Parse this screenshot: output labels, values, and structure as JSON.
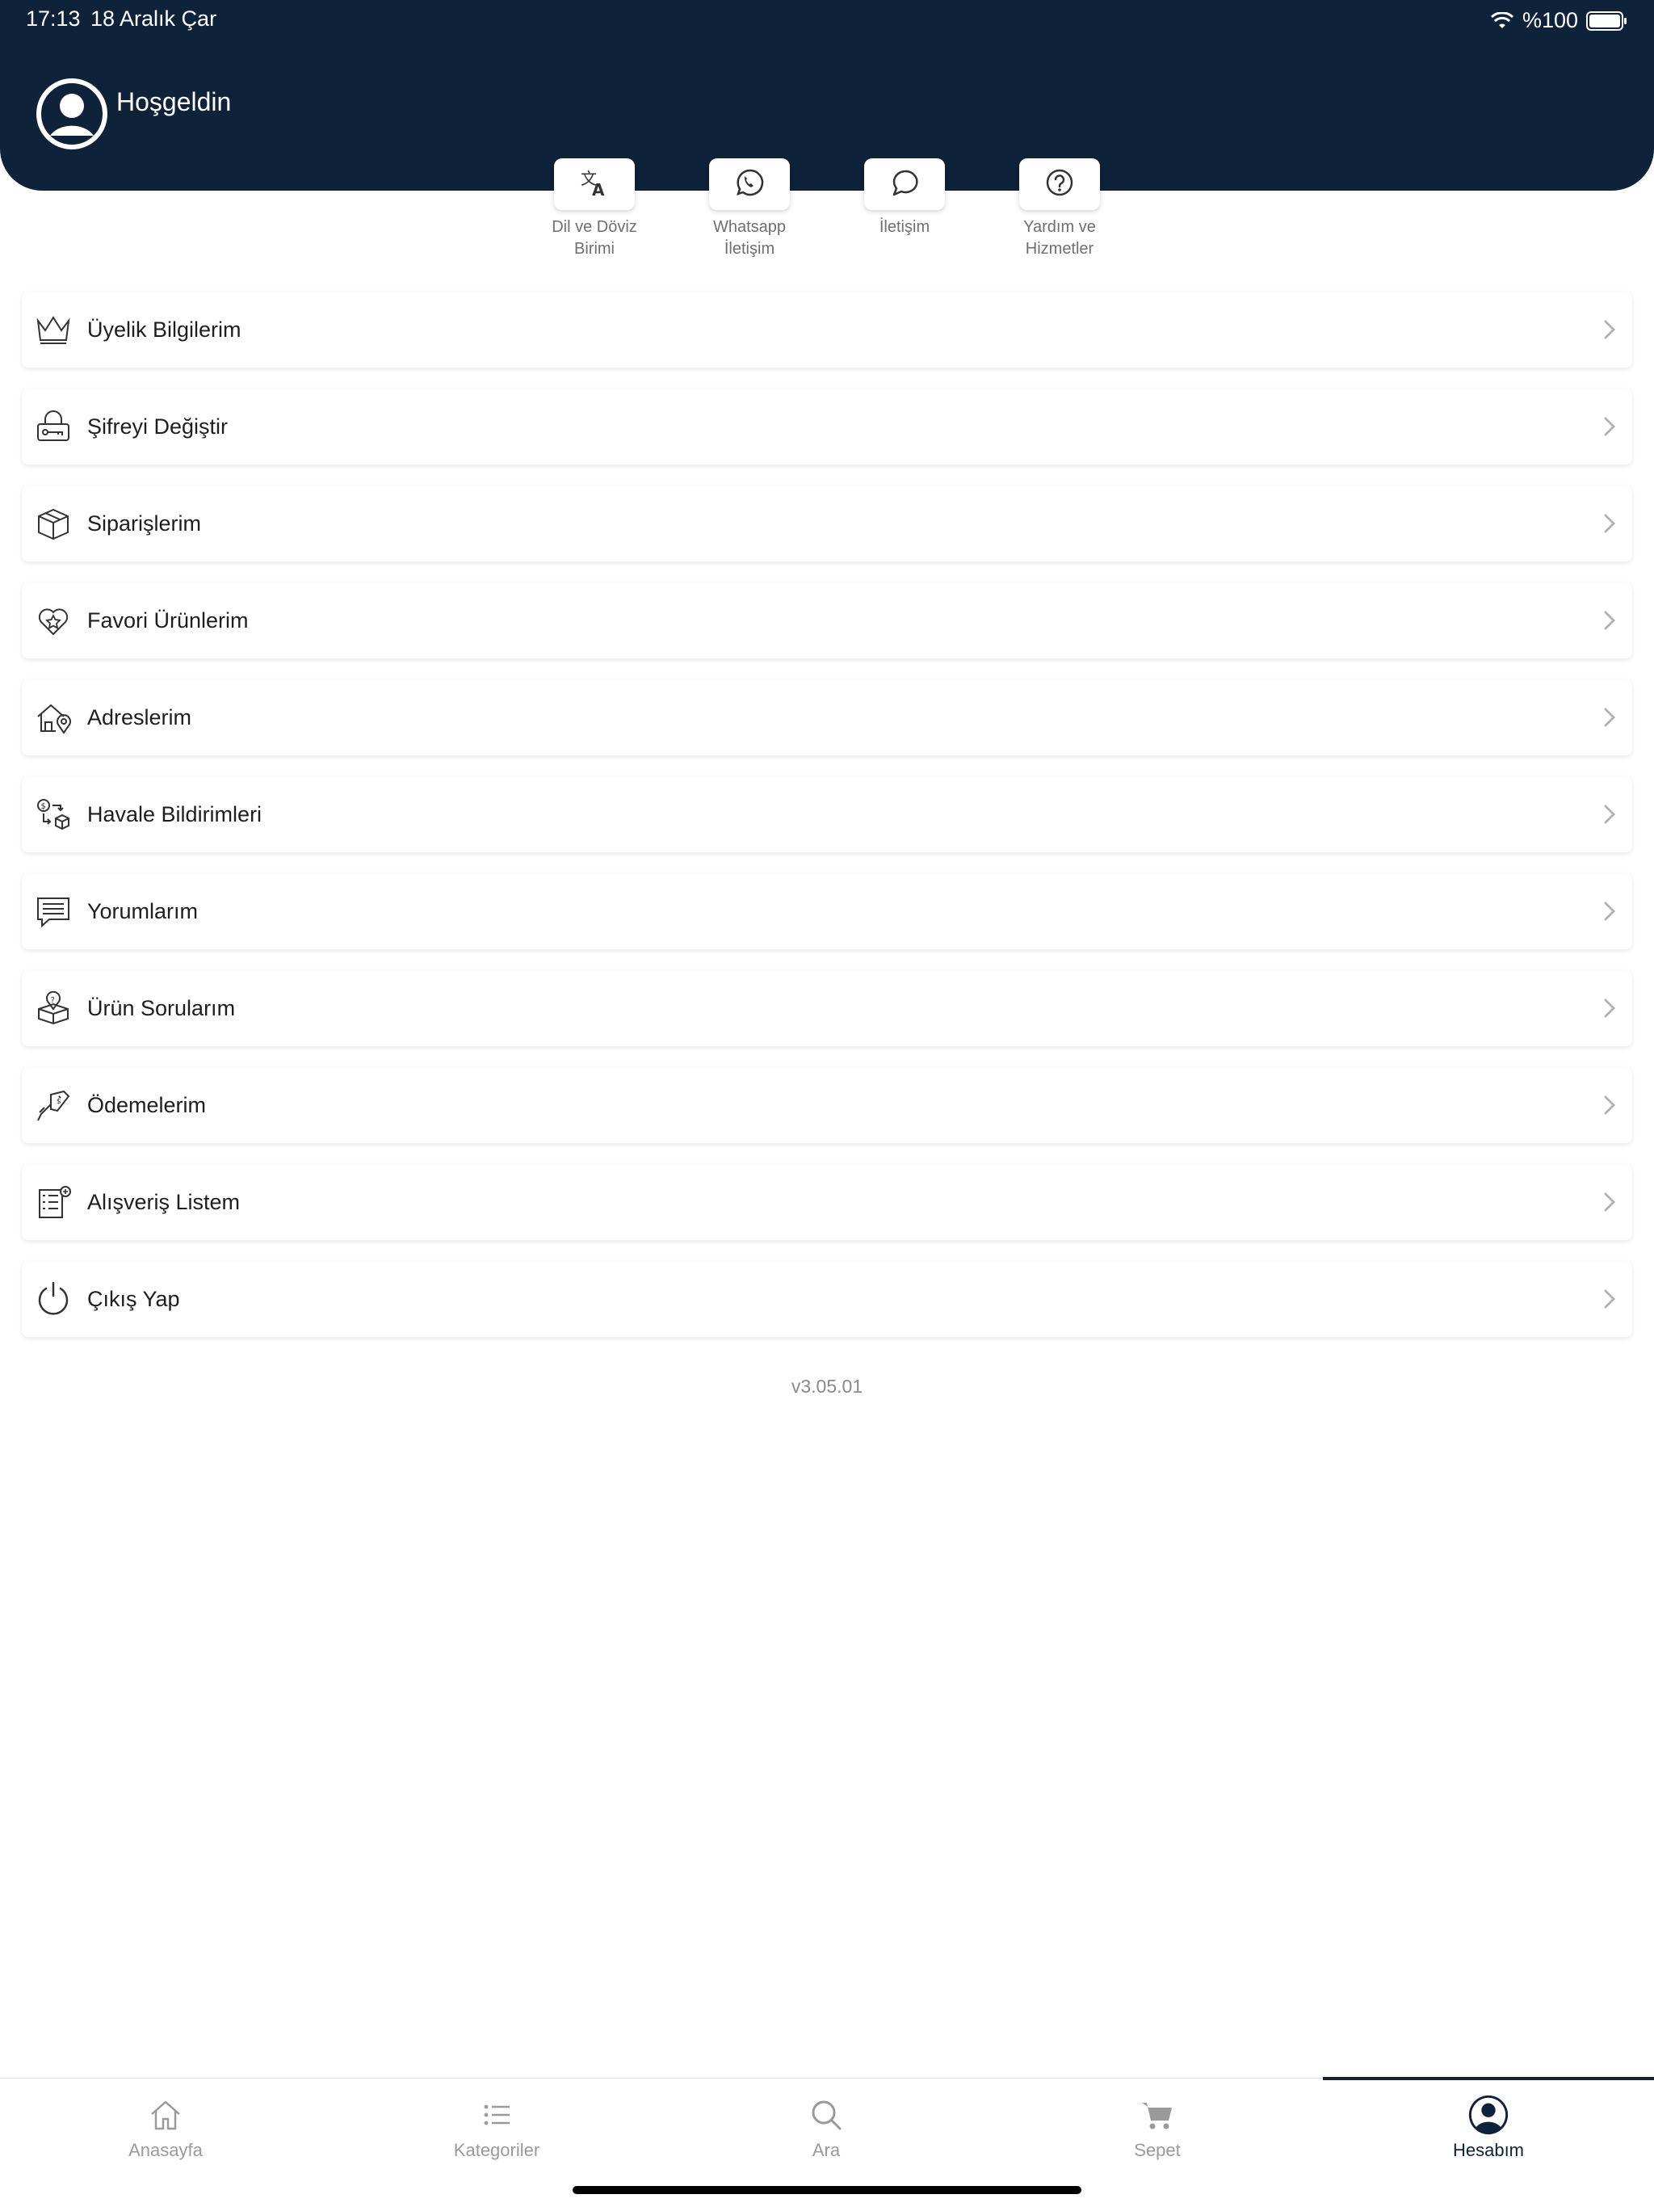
{
  "status_bar": {
    "time": "17:13",
    "date": "18 Aralık Çar",
    "battery": "%100"
  },
  "header": {
    "welcome": "Hoşgeldin",
    "background_color": "#0e223a"
  },
  "quick_actions": [
    {
      "icon": "translate-icon",
      "label_line1": "Dil ve Döviz",
      "label_line2": "Birimi"
    },
    {
      "icon": "whatsapp-icon",
      "label_line1": "Whatsapp",
      "label_line2": "İletişim"
    },
    {
      "icon": "chat-bubble-icon",
      "label_line1": "İletişim",
      "label_line2": ""
    },
    {
      "icon": "help-icon",
      "label_line1": "Yardım ve",
      "label_line2": "Hizmetler"
    }
  ],
  "menu": [
    {
      "icon": "crown-icon",
      "label": "Üyelik Bilgilerim"
    },
    {
      "icon": "lock-key-icon",
      "label": "Şifreyi Değiştir"
    },
    {
      "icon": "package-box-icon",
      "label": "Siparişlerim"
    },
    {
      "icon": "heart-star-icon",
      "label": "Favori Ürünlerim"
    },
    {
      "icon": "home-location-icon",
      "label": "Adreslerim"
    },
    {
      "icon": "money-transfer-icon",
      "label": "Havale Bildirimleri"
    },
    {
      "icon": "comment-icon",
      "label": "Yorumlarım"
    },
    {
      "icon": "question-box-icon",
      "label": "Ürün Sorularım"
    },
    {
      "icon": "card-payment-icon",
      "label": "Ödemelerim"
    },
    {
      "icon": "shopping-list-icon",
      "label": "Alışveriş Listem"
    },
    {
      "icon": "power-icon",
      "label": "Çıkış Yap"
    }
  ],
  "version": "v3.05.01",
  "tabs": [
    {
      "icon": "home-icon",
      "label": "Anasayfa",
      "active": false
    },
    {
      "icon": "list-icon",
      "label": "Kategoriler",
      "active": false
    },
    {
      "icon": "search-icon",
      "label": "Ara",
      "active": false
    },
    {
      "icon": "cart-icon",
      "label": "Sepet",
      "active": false
    },
    {
      "icon": "account-icon",
      "label": "Hesabım",
      "active": true
    }
  ]
}
